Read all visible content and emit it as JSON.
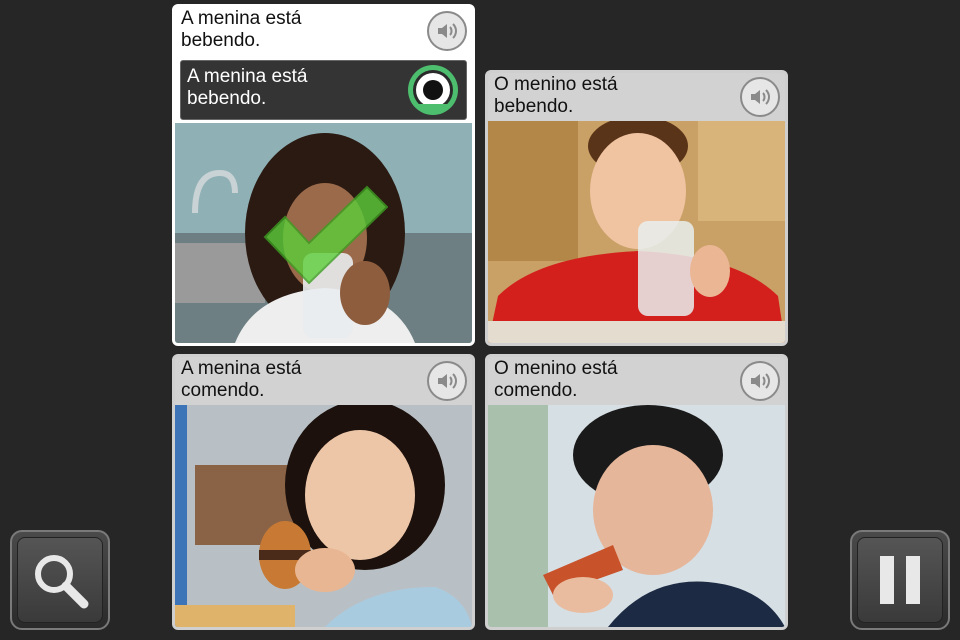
{
  "cards": [
    {
      "id": "top-left",
      "caption": "A menina está\nbebendo.",
      "selected": true,
      "speaker_icon": "speaker-icon"
    },
    {
      "id": "top-right",
      "caption": "O menino está\nbebendo.",
      "selected": false,
      "speaker_icon": "speaker-icon"
    },
    {
      "id": "bottom-left",
      "caption": "A menina está\ncomendo.",
      "selected": false,
      "speaker_icon": "speaker-icon"
    },
    {
      "id": "bottom-right",
      "caption": "O menino está\ncomendo.",
      "selected": false,
      "speaker_icon": "speaker-icon"
    }
  ],
  "answer": {
    "text": "A menina está\nbebendo.",
    "indicator_icon": "record-indicator-icon",
    "result_icon": "checkmark-icon"
  },
  "controls": {
    "left_icon": "magnifier-icon",
    "right_icon": "pause-icon"
  },
  "colors": {
    "background": "#262626",
    "check": "#5ccf3a",
    "indicator": "#4dbd6e"
  }
}
